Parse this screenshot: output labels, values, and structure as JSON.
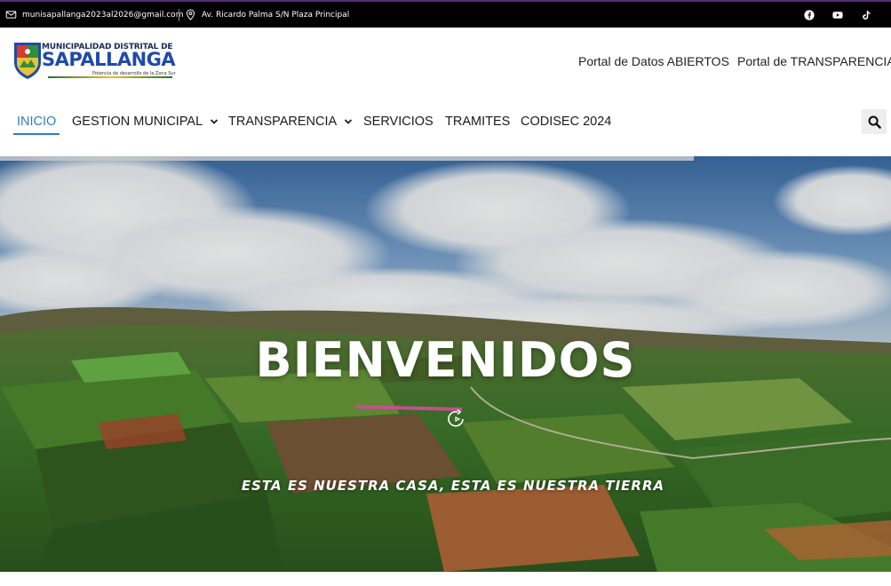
{
  "topbar": {
    "email": "munisapallanga2023al2026@gmail.com",
    "address": "Av. Ricardo Palma S/N Plaza Principal",
    "socials": [
      "facebook-icon",
      "youtube-icon",
      "tiktok-icon"
    ]
  },
  "logo": {
    "line1": "MUNICIPALIDAD DISTRITAL DE",
    "line2": "SAPALLANGA",
    "tagline": "Potencia de desarrollo de la Zona Sur"
  },
  "toplinks": {
    "datos": "Portal de Datos ABIERTOS",
    "transparencia": "Portal de TRANSPARENCIA"
  },
  "nav": {
    "items": [
      {
        "label": "INICIO"
      },
      {
        "label": "GESTION MUNICIPAL"
      },
      {
        "label": "TRANSPARENCIA"
      },
      {
        "label": "SERVICIOS"
      },
      {
        "label": "TRAMITES"
      },
      {
        "label": "CODISEC 2024"
      }
    ]
  },
  "hero": {
    "title": "BIENVENIDOS",
    "subtitle": "ESTA ES NUESTRA CASA, ESTA ES NUESTRA TIERRA"
  },
  "colors": {
    "accent": "#2f7fbf",
    "topbar": "#000000"
  }
}
